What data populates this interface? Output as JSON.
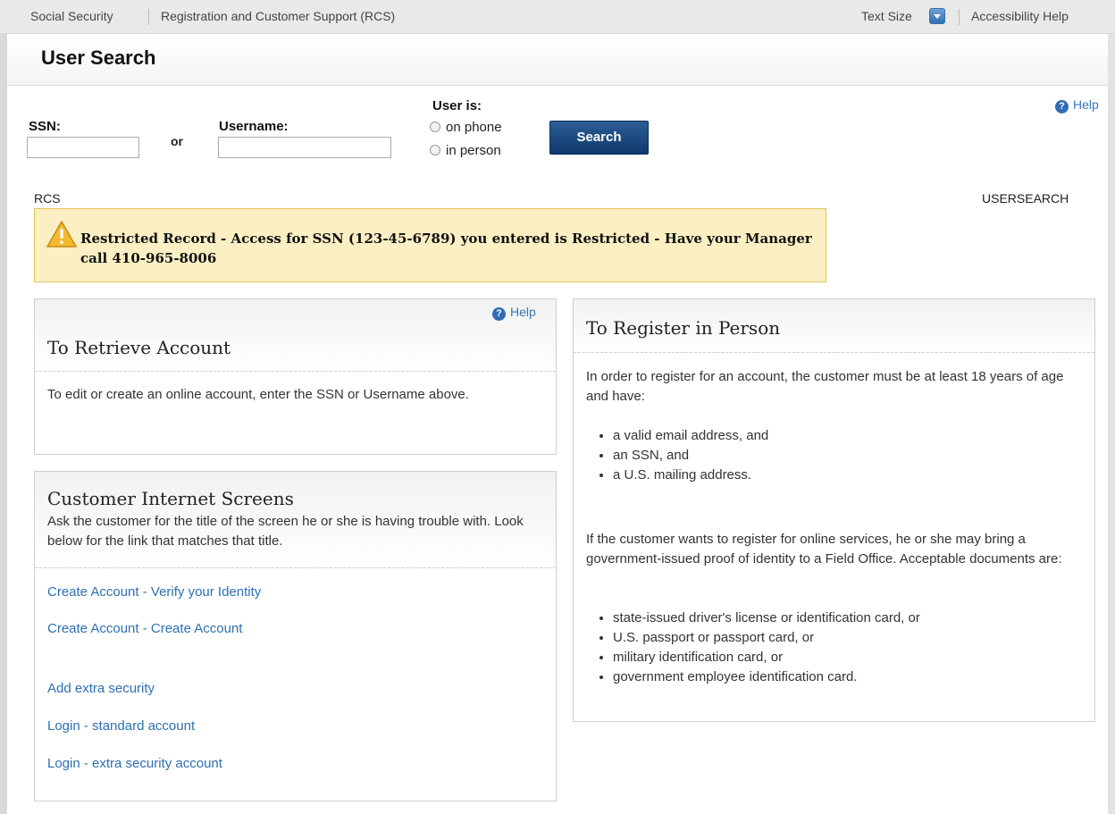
{
  "topbar": {
    "brand": "Social Security",
    "app": "Registration and Customer Support (RCS)",
    "text_size": "Text Size",
    "accessibility": "Accessibility Help"
  },
  "page": {
    "title": "User Search"
  },
  "search": {
    "ssn_label": "SSN:",
    "or_label": "or",
    "username_label": "Username:",
    "user_is_label": "User is:",
    "ssn_value": "",
    "username_value": "",
    "options": [
      "on phone",
      "in person"
    ],
    "button": "Search",
    "help": "Help"
  },
  "breadcrumb": {
    "left": "RCS",
    "right": "USERSEARCH"
  },
  "alert": {
    "message": "Restricted Record - Access for SSN (123-45-6789) you entered is Restricted - Have your Manager call 410-965-8006"
  },
  "retrieve": {
    "help": "Help",
    "title": "To Retrieve Account",
    "body": "To edit or create an online account, enter the SSN or Username above."
  },
  "screens": {
    "title": "Customer Internet Screens",
    "intro": "Ask the customer for the title of the screen he or she is having trouble with. Look below for the link that matches that title.",
    "links": [
      "Create Account - Verify your Identity",
      "Create Account - Create Account",
      "Add extra security",
      "Login - standard account",
      "Login - extra security account"
    ]
  },
  "register": {
    "title": "To Register in Person",
    "intro": "In order to register for an account, the customer must be at least 18 years of age and have:",
    "requirements": [
      "a valid email address, and",
      "an SSN, and",
      "a U.S. mailing address."
    ],
    "online_text": "If the customer wants to register for online services, he or she may bring a government-issued proof of identity to a Field Office. Acceptable documents are:",
    "documents": [
      "state-issued driver's license or identification card, or",
      "U.S. passport or passport card, or",
      "military identification card, or",
      "government employee identification card."
    ]
  },
  "colors": {
    "accent": "#0f3a6c",
    "link": "#2d6fb0",
    "alert_bg": "#fcefc3"
  }
}
